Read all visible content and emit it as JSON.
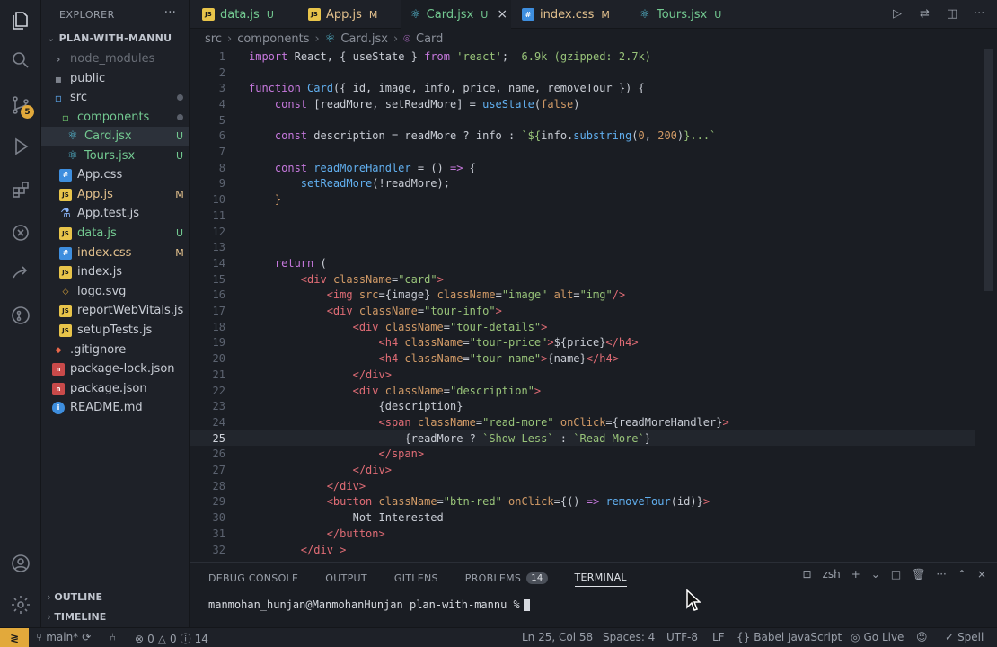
{
  "sidebar": {
    "title": "EXPLORER",
    "root": "PLAN-WITH-MANNU",
    "items": [
      {
        "name": "node_modules",
        "status": ""
      },
      {
        "name": "public",
        "status": ""
      },
      {
        "name": "src",
        "status": ""
      },
      {
        "name": "components",
        "status": ""
      },
      {
        "name": "Card.jsx",
        "status": "U"
      },
      {
        "name": "Tours.jsx",
        "status": "U"
      },
      {
        "name": "App.css",
        "status": ""
      },
      {
        "name": "App.js",
        "status": "M"
      },
      {
        "name": "App.test.js",
        "status": ""
      },
      {
        "name": "data.js",
        "status": "U"
      },
      {
        "name": "index.css",
        "status": "M"
      },
      {
        "name": "index.js",
        "status": ""
      },
      {
        "name": "logo.svg",
        "status": ""
      },
      {
        "name": "reportWebVitals.js",
        "status": ""
      },
      {
        "name": "setupTests.js",
        "status": ""
      },
      {
        "name": ".gitignore",
        "status": ""
      },
      {
        "name": "package-lock.json",
        "status": ""
      },
      {
        "name": "package.json",
        "status": ""
      },
      {
        "name": "README.md",
        "status": ""
      }
    ],
    "outline": "OUTLINE",
    "timeline": "TIMELINE",
    "scm_badge": "5"
  },
  "tabs": [
    {
      "label": "data.js",
      "status": "U"
    },
    {
      "label": "App.js",
      "status": "M"
    },
    {
      "label": "Card.jsx",
      "status": "U"
    },
    {
      "label": "index.css",
      "status": "M"
    },
    {
      "label": "Tours.jsx",
      "status": "U"
    }
  ],
  "breadcrumb": [
    "src",
    "components",
    "Card.jsx",
    "Card"
  ],
  "editor": {
    "import_hint": "6.9k (gzipped: 2.7k)",
    "current_line": 25
  },
  "panel": {
    "tabs": [
      "DEBUG CONSOLE",
      "OUTPUT",
      "GITLENS",
      "PROBLEMS",
      "TERMINAL"
    ],
    "problems_count": "14",
    "shell": "zsh",
    "prompt": "manmohan_hunjan@ManmohanHunjan plan-with-mannu %"
  },
  "status": {
    "branch": "main*",
    "errors": "0",
    "warnings": "0",
    "info": "14",
    "position": "Ln 25, Col 58",
    "spaces": "Spaces: 4",
    "encoding": "UTF-8",
    "eol": "LF",
    "language": "Babel JavaScript",
    "golive": "Go Live",
    "spell": "Spell"
  },
  "colors": {
    "accent": "#e2a93b",
    "untracked": "#73c991",
    "modified": "#e2c08d"
  }
}
